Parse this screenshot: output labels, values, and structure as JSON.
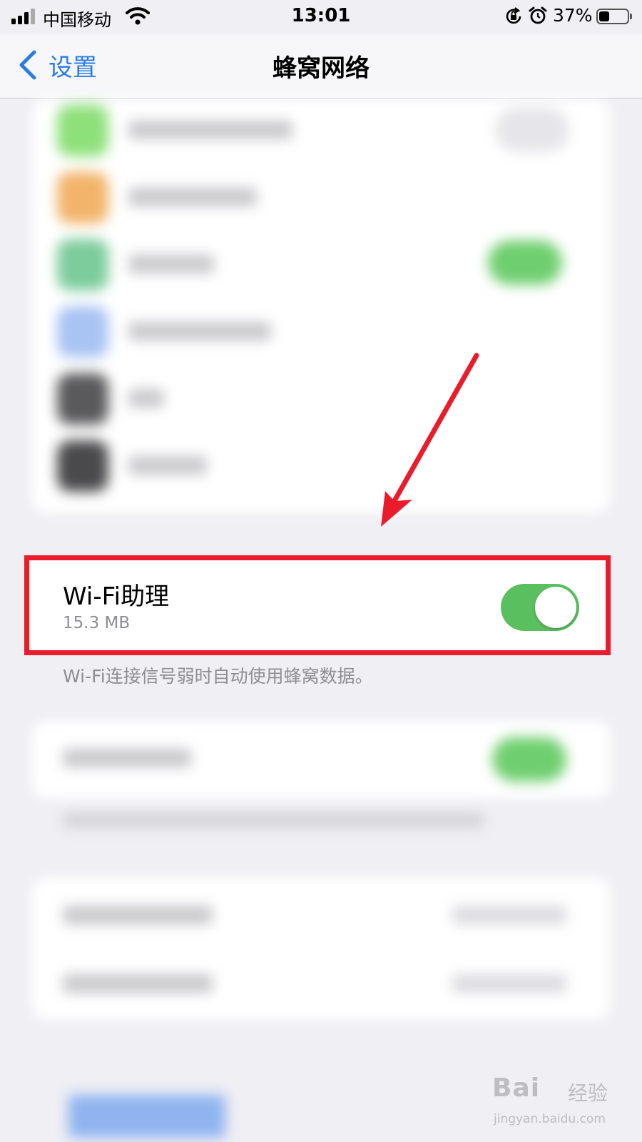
{
  "status_bar": {
    "carrier": "中国移动",
    "time": "13:01",
    "battery_percent": "37%",
    "battery_level": 0.37,
    "icons": [
      "signal-icon",
      "wifi-icon",
      "orientation-lock-icon",
      "alarm-icon",
      "battery-icon"
    ]
  },
  "nav": {
    "back_label": "设置",
    "title": "蜂窝网络"
  },
  "wifi_assist": {
    "title": "Wi-Fi助理",
    "usage": "15.3 MB",
    "enabled": true,
    "footer": "Wi-Fi连接信号弱时自动使用蜂窝数据。"
  },
  "colors": {
    "accent": "#2b7be5",
    "toggle_on": "#5ac05f",
    "highlight": "#ea1c2c",
    "background": "#efeff4"
  },
  "watermark": {
    "brand": "Bai",
    "brand_suffix": "经验",
    "url": "jingyan.baidu.com"
  }
}
